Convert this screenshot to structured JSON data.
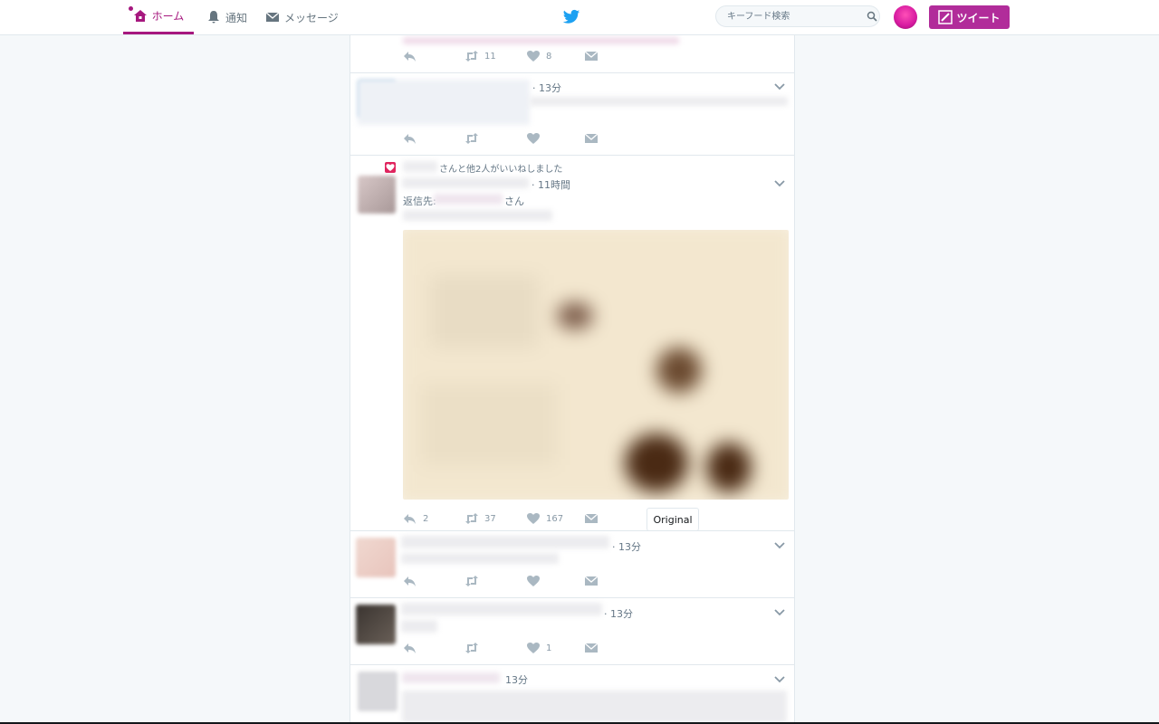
{
  "nav": {
    "home": "ホーム",
    "notifications": "通知",
    "messages": "メッセージ"
  },
  "search": {
    "placeholder": "キーフード検索"
  },
  "tweet_button": "ツイート",
  "colors": {
    "accent": "#a6187e",
    "tweet_button": "#b12c9a",
    "bird": "#1da1f2"
  },
  "tweets": [
    {
      "time": "",
      "reply": "",
      "retweet": "11",
      "like": "8"
    },
    {
      "time": "· 13分",
      "reply": "",
      "retweet": "",
      "like": ""
    },
    {
      "social_context": "さんと他2人がいいねしました",
      "time": "· 11時間",
      "reply_to_prefix": "返信先:",
      "reply_to_suffix": "さん",
      "reply": "2",
      "retweet": "37",
      "like": "167",
      "tooltip": "Original"
    },
    {
      "time": "· 13分",
      "reply": "",
      "retweet": "",
      "like": ""
    },
    {
      "time": "· 13分",
      "reply": "",
      "retweet": "",
      "like": "1"
    },
    {
      "time": "13分"
    }
  ]
}
